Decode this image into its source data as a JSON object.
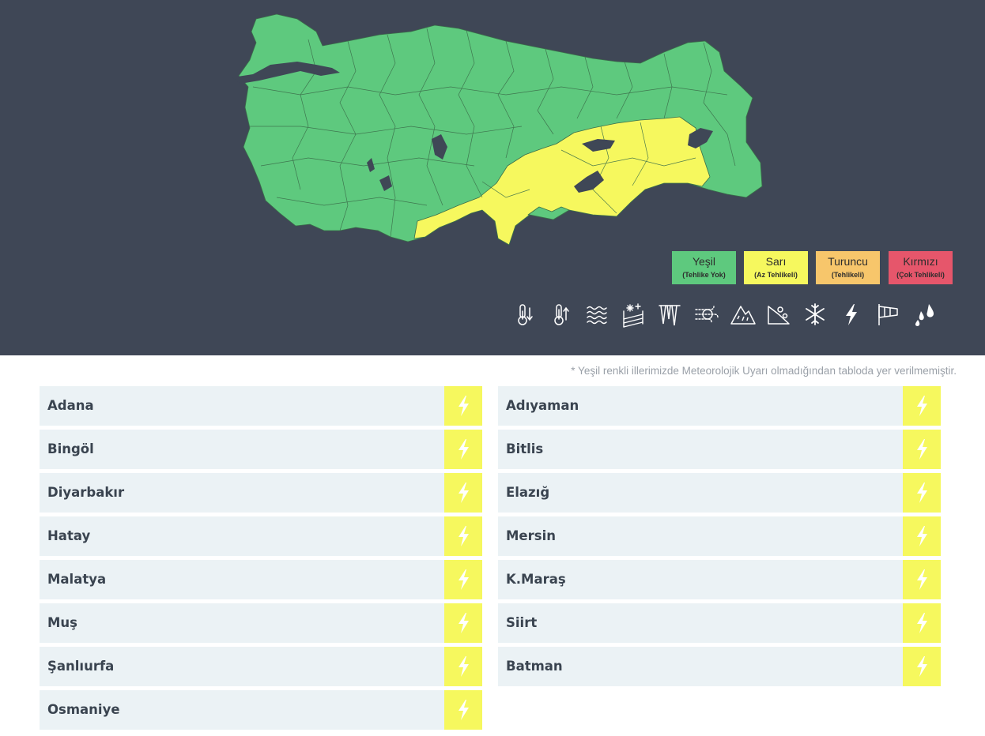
{
  "legend": [
    {
      "label": "Yeşil",
      "sub": "(Tehlike Yok)",
      "color": "#5ec97e"
    },
    {
      "label": "Sarı",
      "sub": "(Az Tehlikeli)",
      "color": "#f6f85e"
    },
    {
      "label": "Turuncu",
      "sub": "(Tehlikeli)",
      "color": "#f7c66b"
    },
    {
      "label": "Kırmızı",
      "sub": "(Çok Tehlikeli)",
      "color": "#e6566b"
    }
  ],
  "hazard_icons": [
    "cold-icon",
    "heat-icon",
    "fog-icon",
    "snow-rain-icon",
    "icing-icon",
    "wind-icon",
    "avalanche-icon",
    "landslide-icon",
    "snow-icon",
    "thunderstorm-icon",
    "strong-wind-icon",
    "rain-icon"
  ],
  "note": "* Yeşil renkli illerimizde Meteorolojik Uyarı olmadığından tabloda yer verilmemiştir.",
  "colors": {
    "header_bg": "#3f4756",
    "green": "#5ec97e",
    "yellow": "#f6f85e",
    "row_bg": "#ebf2f5"
  },
  "provinces_left": [
    {
      "name": "Adana",
      "warning": "thunderstorm"
    },
    {
      "name": "Bingöl",
      "warning": "thunderstorm"
    },
    {
      "name": "Diyarbakır",
      "warning": "thunderstorm"
    },
    {
      "name": "Hatay",
      "warning": "thunderstorm"
    },
    {
      "name": "Malatya",
      "warning": "thunderstorm"
    },
    {
      "name": "Muş",
      "warning": "thunderstorm"
    },
    {
      "name": "Şanlıurfa",
      "warning": "thunderstorm"
    },
    {
      "name": "Osmaniye",
      "warning": "thunderstorm"
    }
  ],
  "provinces_right": [
    {
      "name": "Adıyaman",
      "warning": "thunderstorm"
    },
    {
      "name": "Bitlis",
      "warning": "thunderstorm"
    },
    {
      "name": "Elazığ",
      "warning": "thunderstorm"
    },
    {
      "name": "Mersin",
      "warning": "thunderstorm"
    },
    {
      "name": "K.Maraş",
      "warning": "thunderstorm"
    },
    {
      "name": "Siirt",
      "warning": "thunderstorm"
    },
    {
      "name": "Batman",
      "warning": "thunderstorm"
    }
  ]
}
